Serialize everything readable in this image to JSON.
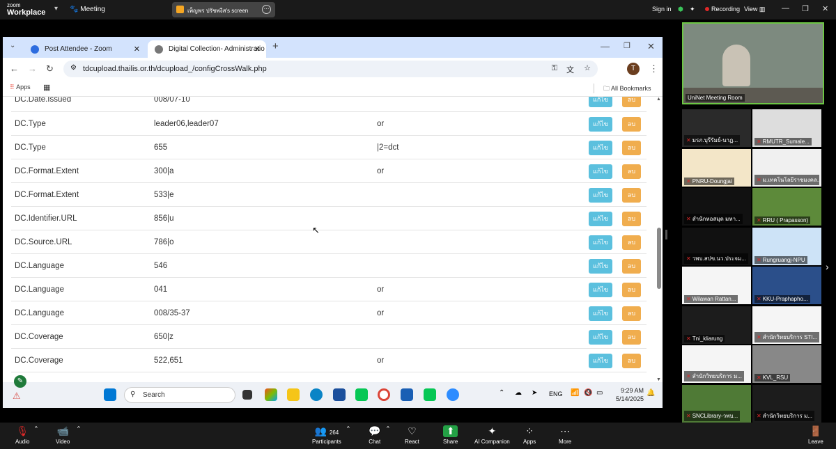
{
  "zoom": {
    "logo_small": "zoom",
    "logo_big": "Workplace",
    "meeting_label": "Meeting",
    "share_label": "เพ็ญพร ปรัชพงีส's screen",
    "signin": "Sign in",
    "recording": "Recording",
    "view": "View"
  },
  "browser": {
    "tabs": [
      {
        "label": "Post Attendee - Zoom"
      },
      {
        "label": "Digital Collection- Administratio"
      }
    ],
    "new_tab": "+",
    "url": "tdcupload.thailis.or.th/dcupload_/configCrossWalk.php",
    "profile_initial": "T",
    "bookmarks_apps": "Apps",
    "all_bookmarks": "All Bookmarks"
  },
  "table": {
    "edit_label": "แก้ไข",
    "delete_label": "ลบ",
    "rows": [
      {
        "field": "DC.Date.Issued",
        "tag": "008/07-10",
        "extra": ""
      },
      {
        "field": "DC.Type",
        "tag": "leader06,leader07",
        "extra": "or"
      },
      {
        "field": "DC.Type",
        "tag": "655",
        "extra": "|2=dct"
      },
      {
        "field": "DC.Format.Extent",
        "tag": "300|a",
        "extra": "or"
      },
      {
        "field": "DC.Format.Extent",
        "tag": "533|e",
        "extra": ""
      },
      {
        "field": "DC.Identifier.URL",
        "tag": "856|u",
        "extra": ""
      },
      {
        "field": "DC.Source.URL",
        "tag": "786|o",
        "extra": ""
      },
      {
        "field": "DC.Language",
        "tag": "546",
        "extra": ""
      },
      {
        "field": "DC.Language",
        "tag": "041",
        "extra": "or"
      },
      {
        "field": "DC.Language",
        "tag": "008/35-37",
        "extra": "or"
      },
      {
        "field": "DC.Coverage",
        "tag": "650|z",
        "extra": ""
      },
      {
        "field": "DC.Coverage",
        "tag": "522,651",
        "extra": "or"
      }
    ]
  },
  "taskbar": {
    "search_placeholder": "Search",
    "lang": "ENG",
    "time": "9:29 AM",
    "date": "5/14/2025"
  },
  "gallery": {
    "speaker_name": "UniNet Meeting Room",
    "participants": [
      "มรภ.บุรีรัมย์-นาฏ...",
      "RMUTR_Sumale...",
      "PNRU-Doungjai",
      "ม.เทคโนโลยีราชมงคล...",
      "สำนักหอสมุด มหา...",
      "RRU ( Prapasson)",
      "วพบ.สปข.นว.ประจม...",
      "Rungruangj-NPU",
      "Wilawan Rattan...",
      "KKU-Praphapho...",
      "Tni_kliarung",
      "สำนักวิทยบริการ STI...",
      "สำนักวิทยบริการ ม...",
      "KVL_RSU",
      "SNCLibrary-วพบ...",
      "สำนักวิทยบริการ ม..."
    ]
  },
  "toolbar": {
    "audio": "Audio",
    "video": "Video",
    "participants": "Participants",
    "participants_count": "264",
    "chat": "Chat",
    "react": "React",
    "share": "Share",
    "ai": "AI Companion",
    "apps": "Apps",
    "more": "More",
    "leave": "Leave"
  }
}
